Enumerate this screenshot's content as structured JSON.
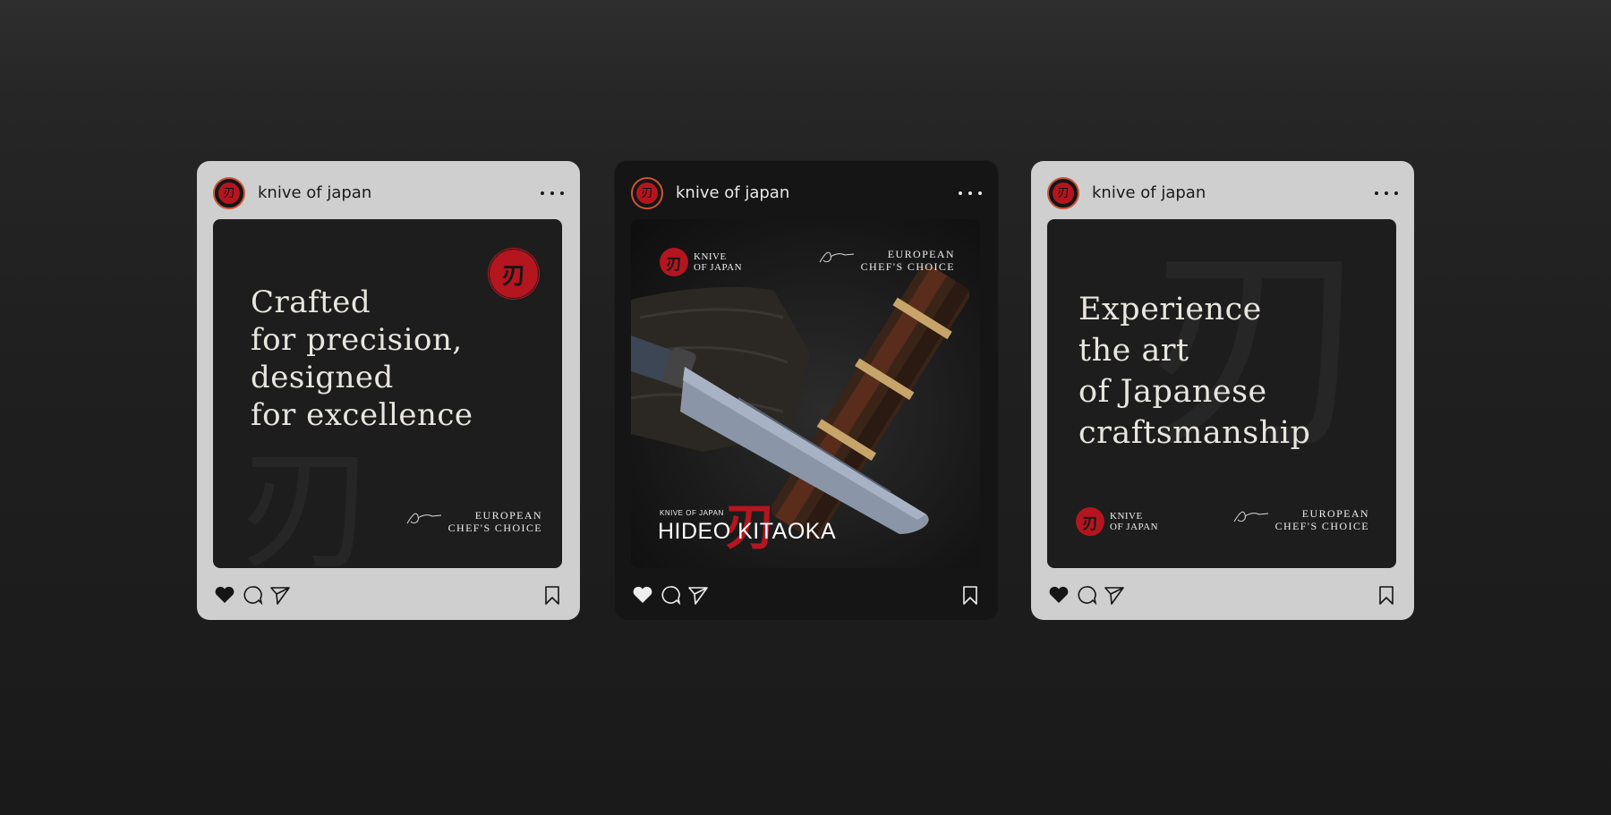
{
  "posts": [
    {
      "username": "knive of japan",
      "headline_lines": [
        "Crafted",
        "for precision,",
        "designed",
        "for excellence"
      ],
      "european_lines": [
        "EUROPEAN",
        "CHEF'S CHOICE"
      ],
      "kanji": "刃"
    },
    {
      "username": "knive of japan",
      "brand_lines": [
        "KNIVE",
        "OF JAPAN"
      ],
      "european_lines": [
        "EUROPEAN",
        "CHEF'S CHOICE"
      ],
      "maker_small": "KNIVE OF JAPAN",
      "maker_name": "HIDEO KITAOKA",
      "kanji": "刃"
    },
    {
      "username": "knive of japan",
      "headline_lines": [
        "Experience",
        "the art",
        "of Japanese",
        "craftsmanship"
      ],
      "brand_lines": [
        "KNIVE",
        "OF JAPAN"
      ],
      "european_lines": [
        "EUROPEAN",
        "CHEF'S CHOICE"
      ],
      "kanji": "刃"
    }
  ],
  "colors": {
    "accent_red": "#b4151f",
    "light_card": "#cfcfcf",
    "dark_card": "#151515",
    "post_bg": "#1d1d1d"
  },
  "icons": [
    "more-icon",
    "heart-icon",
    "comment-icon",
    "share-icon",
    "bookmark-icon"
  ]
}
